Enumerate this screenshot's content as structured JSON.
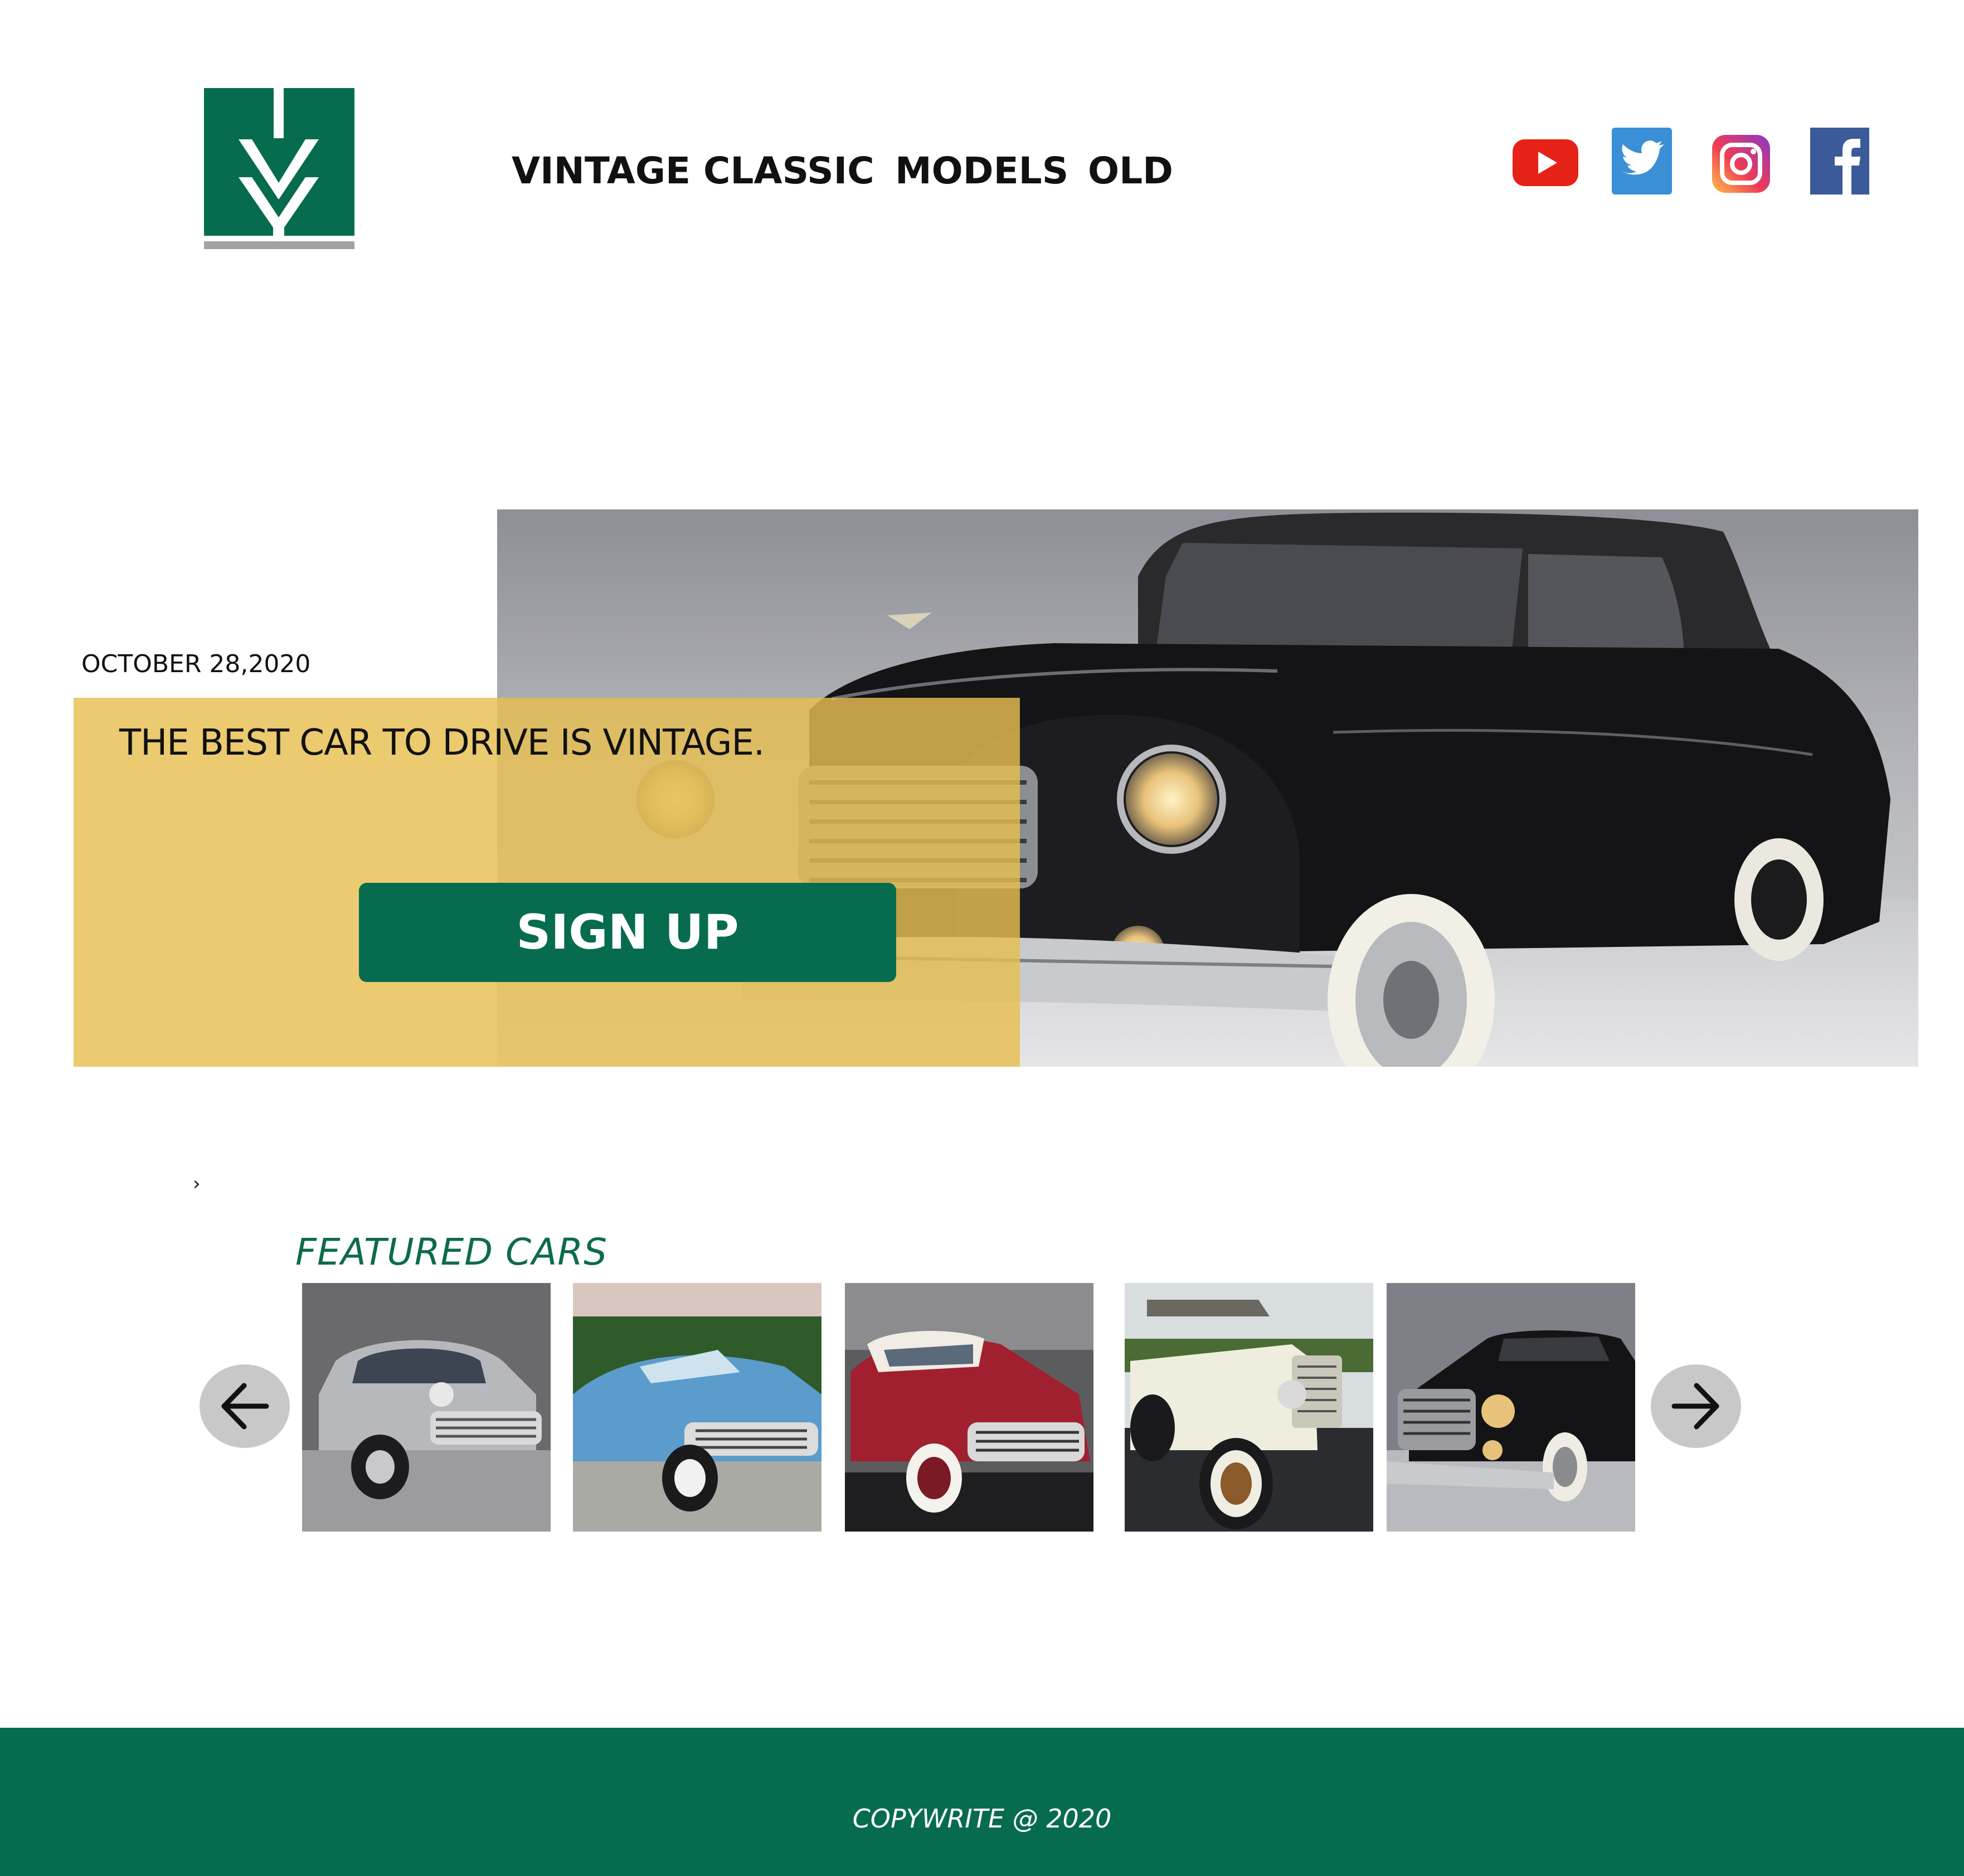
{
  "header": {
    "logo_icon": "ivy-logo-icon",
    "nav": [
      {
        "label": "VINTAGE"
      },
      {
        "label": "CLASSIC"
      },
      {
        "label": "MODELS"
      },
      {
        "label": "OLD"
      }
    ],
    "social_icons": [
      "youtube-icon",
      "twitter-icon",
      "instagram-icon",
      "facebook-icon"
    ]
  },
  "hero": {
    "date": "OCTOBER 28,2020",
    "headline": "THE BEST CAR TO DRIVE IS VINTAGE.",
    "signup_label": "SIGN UP"
  },
  "breadcrumb_chevron": "›",
  "featured": {
    "title": "FEATURED CARS",
    "prev_icon": "arrow-left-icon",
    "next_icon": "arrow-right-icon"
  },
  "footer": {
    "text": "COPYWRITE @ 2020"
  },
  "colors": {
    "brand_green": "#076c4f",
    "hero_panel": "#e6be50",
    "arrow_button": "#c8c8c8",
    "logo_underline": "#a3a3a3"
  }
}
